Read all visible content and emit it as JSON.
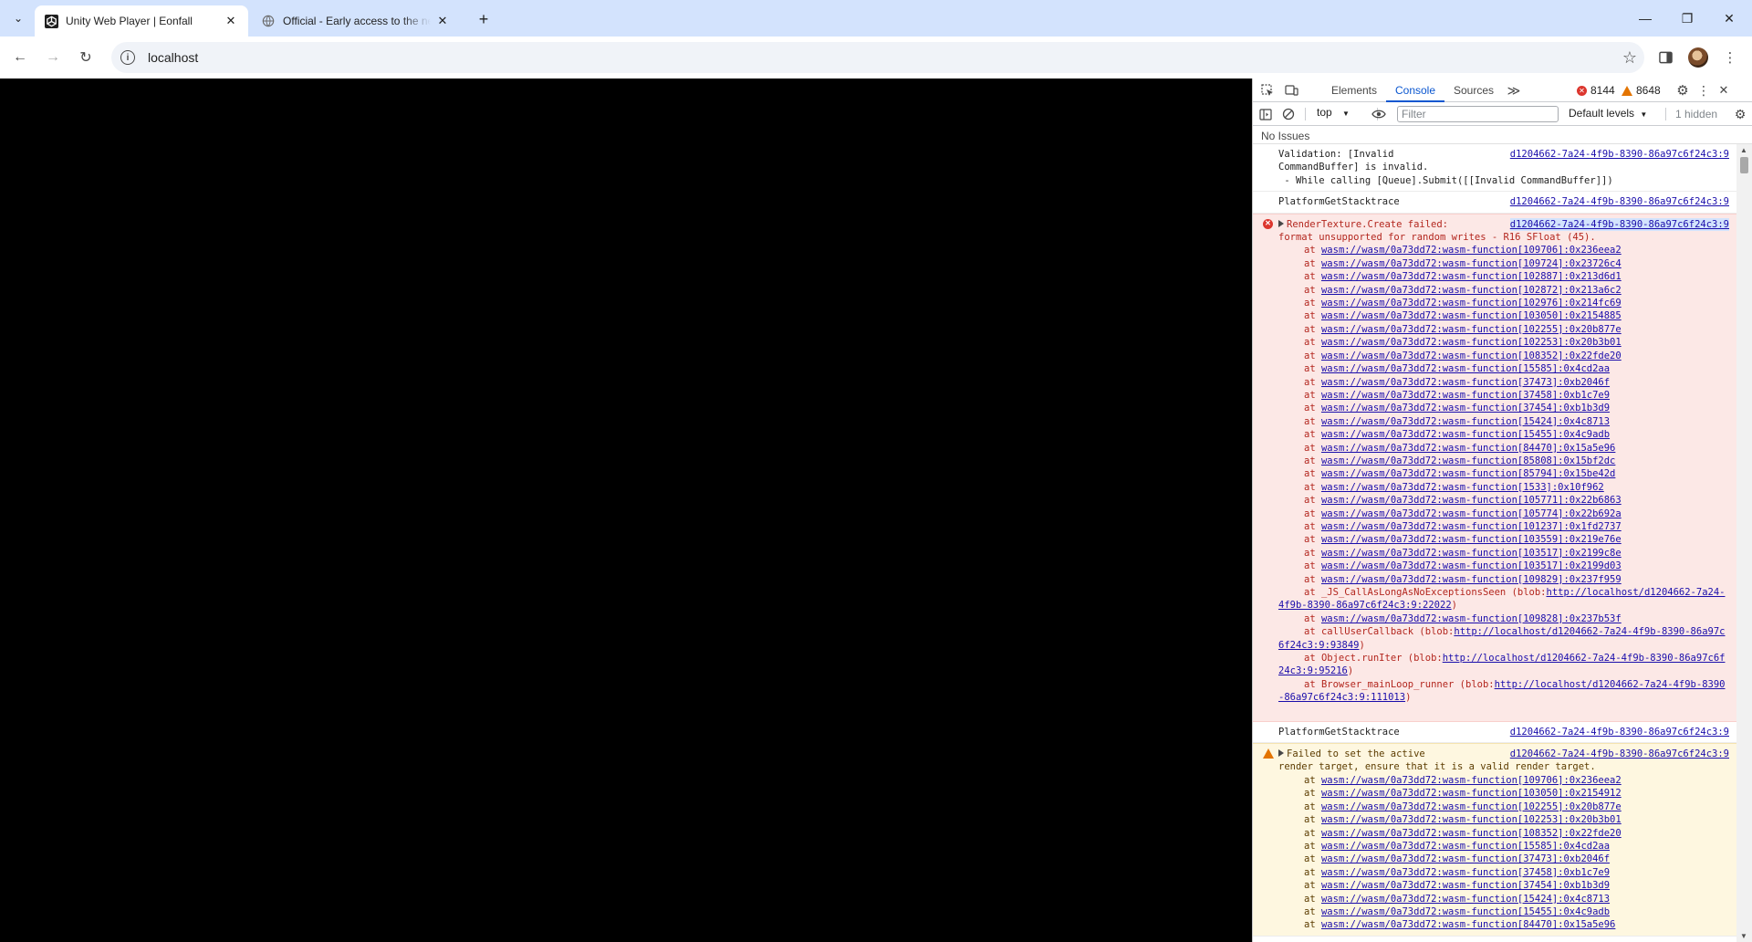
{
  "tabs": [
    {
      "title": "Unity Web Player | Eonfall",
      "active": true
    },
    {
      "title": "Official - Early access to the new",
      "active": false
    }
  ],
  "address": {
    "url": "localhost"
  },
  "devtools": {
    "tabs": [
      "Elements",
      "Console",
      "Sources"
    ],
    "errors": "8144",
    "warnings": "8648",
    "context": "top",
    "filter_placeholder": "Filter",
    "levels": "Default levels",
    "hidden": "1 hidden",
    "issues": "No Issues"
  },
  "console": {
    "msg1": {
      "text": "Validation: [Invalid\nCommandBuffer] is invalid.\n - While calling [Queue].Submit([[Invalid CommandBuffer]])",
      "source": "d1204662-7a24-4f9b-8390-86a97c6f24c3:9"
    },
    "msg2": {
      "text": "PlatformGetStacktrace",
      "source": "d1204662-7a24-4f9b-8390-86a97c6f24c3:9"
    },
    "msg3": {
      "text": "RenderTexture.Create failed:\nformat unsupported for random writes - R16 SFloat (45).",
      "source": "d1204662-7a24-4f9b-8390-86a97c6f24c3:9",
      "frames": [
        "wasm://wasm/0a73dd72:wasm-function[109706]:0x236eea2",
        "wasm://wasm/0a73dd72:wasm-function[109724]:0x23726c4",
        "wasm://wasm/0a73dd72:wasm-function[102887]:0x213d6d1",
        "wasm://wasm/0a73dd72:wasm-function[102872]:0x213a6c2",
        "wasm://wasm/0a73dd72:wasm-function[102976]:0x214fc69",
        "wasm://wasm/0a73dd72:wasm-function[103050]:0x2154885",
        "wasm://wasm/0a73dd72:wasm-function[102255]:0x20b877e",
        "wasm://wasm/0a73dd72:wasm-function[102253]:0x20b3b01",
        "wasm://wasm/0a73dd72:wasm-function[108352]:0x22fde20",
        "wasm://wasm/0a73dd72:wasm-function[15585]:0x4cd2aa",
        "wasm://wasm/0a73dd72:wasm-function[37473]:0xb2046f",
        "wasm://wasm/0a73dd72:wasm-function[37458]:0xb1c7e9",
        "wasm://wasm/0a73dd72:wasm-function[37454]:0xb1b3d9",
        "wasm://wasm/0a73dd72:wasm-function[15424]:0x4c8713",
        "wasm://wasm/0a73dd72:wasm-function[15455]:0x4c9adb",
        "wasm://wasm/0a73dd72:wasm-function[84470]:0x15a5e96",
        "wasm://wasm/0a73dd72:wasm-function[85808]:0x15bf2dc",
        "wasm://wasm/0a73dd72:wasm-function[85794]:0x15be42d",
        "wasm://wasm/0a73dd72:wasm-function[1533]:0x10f962",
        "wasm://wasm/0a73dd72:wasm-function[105771]:0x22b6863",
        "wasm://wasm/0a73dd72:wasm-function[105774]:0x22b692a",
        "wasm://wasm/0a73dd72:wasm-function[101237]:0x1fd2737",
        "wasm://wasm/0a73dd72:wasm-function[103559]:0x219e76e",
        "wasm://wasm/0a73dd72:wasm-function[103517]:0x2199c8e",
        "wasm://wasm/0a73dd72:wasm-function[103517]:0x2199d03",
        "wasm://wasm/0a73dd72:wasm-function[109829]:0x237f959"
      ],
      "frame_js1": {
        "prefix": "at _JS_CallAsLongAsNoExceptionsSeen (blob:",
        "link": "http://localhost/d1204662-7a24-4f9b-8390-86a97c6f24c3:9:22022",
        "suffix": ")"
      },
      "frame_wasm_last": "wasm://wasm/0a73dd72:wasm-function[109828]:0x237b53f",
      "frame_js2": {
        "prefix": "at callUserCallback (blob:",
        "link": "http://localhost/d1204662-7a24-4f9b-8390-86a97c6f24c3:9:93849",
        "suffix": ")"
      },
      "frame_js3": {
        "prefix": "at Object.runIter (blob:",
        "link": "http://localhost/d1204662-7a24-4f9b-8390-86a97c6f24c3:9:95216",
        "suffix": ")"
      },
      "frame_js4": {
        "prefix": "at Browser_mainLoop_runner (blob:",
        "link": "http://localhost/d1204662-7a24-4f9b-8390-86a97c6f24c3:9:111013",
        "suffix": ")"
      }
    },
    "msg4": {
      "text": "PlatformGetStacktrace",
      "source": "d1204662-7a24-4f9b-8390-86a97c6f24c3:9"
    },
    "msg5": {
      "text": "Failed to set the active\nrender target, ensure that it is a valid render target.",
      "source": "d1204662-7a24-4f9b-8390-86a97c6f24c3:9",
      "frames": [
        "wasm://wasm/0a73dd72:wasm-function[109706]:0x236eea2",
        "wasm://wasm/0a73dd72:wasm-function[103050]:0x2154912",
        "wasm://wasm/0a73dd72:wasm-function[102255]:0x20b877e",
        "wasm://wasm/0a73dd72:wasm-function[102253]:0x20b3b01",
        "wasm://wasm/0a73dd72:wasm-function[108352]:0x22fde20",
        "wasm://wasm/0a73dd72:wasm-function[15585]:0x4cd2aa",
        "wasm://wasm/0a73dd72:wasm-function[37473]:0xb2046f",
        "wasm://wasm/0a73dd72:wasm-function[37458]:0xb1c7e9",
        "wasm://wasm/0a73dd72:wasm-function[37454]:0xb1b3d9",
        "wasm://wasm/0a73dd72:wasm-function[15424]:0x4c8713",
        "wasm://wasm/0a73dd72:wasm-function[15455]:0x4c9adb",
        "wasm://wasm/0a73dd72:wasm-function[84470]:0x15a5e96"
      ]
    },
    "frame_at": "at"
  }
}
